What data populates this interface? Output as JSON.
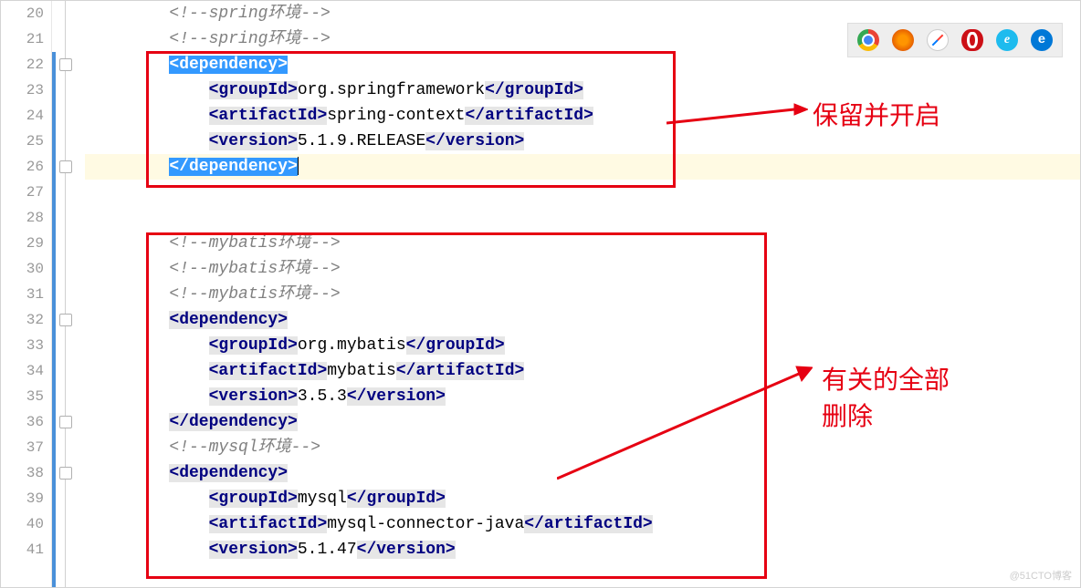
{
  "gutter": {
    "start": 20,
    "end": 41
  },
  "annotations": {
    "keep_enable": "保留并开启",
    "delete_all_line1": "有关的全部",
    "delete_all_line2": "删除"
  },
  "code": {
    "l20": "<!--spring环境-->",
    "l21": "<!--spring环境-->",
    "l22_open": "<dependency>",
    "l23_tag1": "<groupId>",
    "l23_txt": "org.springframework",
    "l23_tag2": "</groupId>",
    "l24_tag1": "<artifactId>",
    "l24_txt": "spring-context",
    "l24_tag2": "</artifactId>",
    "l25_tag1": "<version>",
    "l25_txt": "5.1.9.RELEASE",
    "l25_tag2": "</version>",
    "l26_close": "</dependency>",
    "l29": "<!--mybatis环境-->",
    "l30": "<!--mybatis环境-->",
    "l31": "<!--mybatis环境-->",
    "l32_open": "<dependency>",
    "l33_tag1": "<groupId>",
    "l33_txt": "org.mybatis",
    "l33_tag2": "</groupId>",
    "l34_tag1": "<artifactId>",
    "l34_txt": "mybatis",
    "l34_tag2": "</artifactId>",
    "l35_tag1": "<version>",
    "l35_txt": "3.5.3",
    "l35_tag2": "</version>",
    "l36_close": "</dependency>",
    "l37": "<!--mysql环境-->",
    "l38_open": "<dependency>",
    "l39_tag1": "<groupId>",
    "l39_txt": "mysql",
    "l39_tag2": "</groupId>",
    "l40_tag1": "<artifactId>",
    "l40_txt": "mysql-connector-java",
    "l40_tag2": "</artifactId>",
    "l41_tag1": "<version>",
    "l41_txt": "5.1.47",
    "l41_tag2": "</version>"
  },
  "watermark": "@51CTO博客"
}
